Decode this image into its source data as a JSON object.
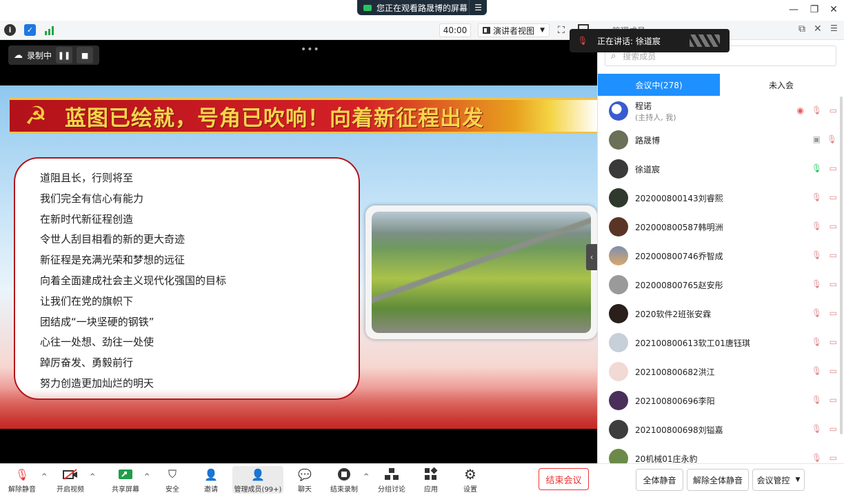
{
  "window": {
    "share_notice": "您正在观看路晟博的屏幕",
    "minimize_glyph": "—",
    "restore_glyph": "❐",
    "close_glyph": "✕"
  },
  "toolbar": {
    "timer": "40:00",
    "view_mode": "演讲者视图"
  },
  "recording": {
    "label": "录制中"
  },
  "slide": {
    "title": "蓝图已绘就，号角已吹响！向着新征程出发",
    "lines": [
      "道阻且长，行则将至",
      "我们完全有信心有能力",
      "在新时代新征程创造",
      "令世人刮目相看的新的更大奇迹",
      "新征程是充满光荣和梦想的远征",
      "向着全面建成社会主义现代化强国的目标",
      "让我们在党的旗帜下",
      "团结成“一块坚硬的钢铁”",
      "心往一处想、劲往一处使",
      "踔厉奋发、勇毅前行",
      "努力创造更加灿烂的明天"
    ]
  },
  "speaking": {
    "label": "正在讲话: 徐道宸"
  },
  "controls": {
    "unmute": "解除静音",
    "start_video": "开启视频",
    "share_screen": "共享屏幕",
    "security": "安全",
    "invite": "邀请",
    "members": "管理成员(99+)",
    "chat": "聊天",
    "end_record": "结束录制",
    "breakout": "分组讨论",
    "apps": "应用",
    "settings": "设置",
    "end_meeting": "结束会议"
  },
  "panel": {
    "title": "管理成员",
    "search_placeholder": "搜索成员",
    "tab_in_meeting": "会议中(278)",
    "tab_not_joined": "未入会",
    "members": [
      {
        "name": "程诺",
        "sub": "(主持人, 我)"
      },
      {
        "name": "路晟博",
        "sub": ""
      },
      {
        "name": "徐道宸",
        "sub": ""
      },
      {
        "name": "202000800143刘睿熙",
        "sub": ""
      },
      {
        "name": "202000800587韩明洲",
        "sub": ""
      },
      {
        "name": "202000800746乔智成",
        "sub": ""
      },
      {
        "name": "202000800765赵安彤",
        "sub": ""
      },
      {
        "name": "2020软件2班张安霖",
        "sub": ""
      },
      {
        "name": "202100800613软工01唐钰琪",
        "sub": ""
      },
      {
        "name": "202100800682洪江",
        "sub": ""
      },
      {
        "name": "202100800696李阳",
        "sub": ""
      },
      {
        "name": "202100800698刘镒嘉",
        "sub": ""
      },
      {
        "name": "20机械01庄永豹",
        "sub": ""
      }
    ],
    "mute_all": "全体静音",
    "unmute_all": "解除全体静音",
    "meeting_control": "会议管控"
  }
}
